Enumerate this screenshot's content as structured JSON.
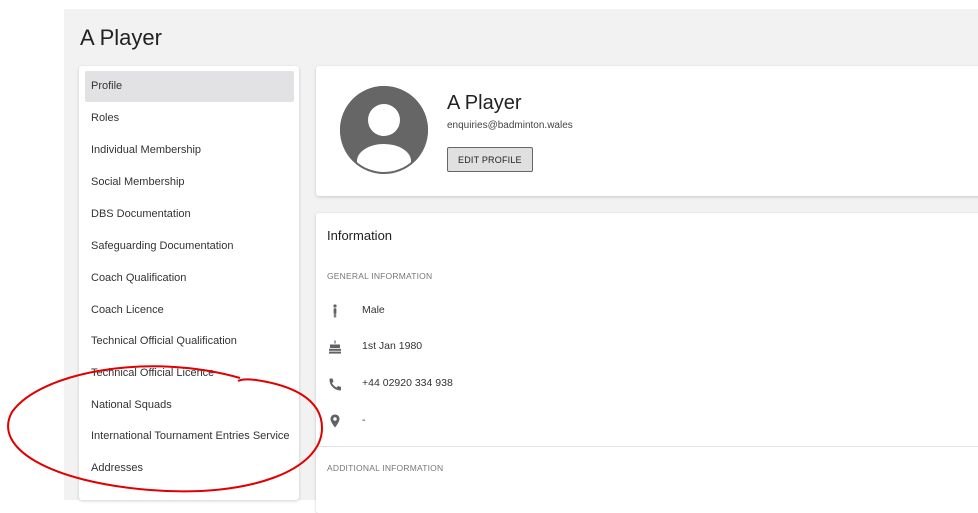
{
  "page": {
    "title": "A Player"
  },
  "sidebar": {
    "items": [
      {
        "label": "Profile",
        "active": true
      },
      {
        "label": "Roles"
      },
      {
        "label": "Individual Membership"
      },
      {
        "label": "Social Membership"
      },
      {
        "label": "DBS Documentation"
      },
      {
        "label": "Safeguarding Documentation"
      },
      {
        "label": "Coach Qualification"
      },
      {
        "label": "Coach Licence"
      },
      {
        "label": "Technical Official Qualification"
      },
      {
        "label": "Technical Official Licence"
      },
      {
        "label": "National Squads"
      },
      {
        "label": "International Tournament Entries Service"
      },
      {
        "label": "Addresses"
      }
    ]
  },
  "profile": {
    "name": "A Player",
    "email": "enquiries@badminton.wales",
    "edit_label": "EDIT PROFILE",
    "avatar_icon": "account-circle-icon"
  },
  "information": {
    "title": "Information",
    "general_label": "GENERAL INFORMATION",
    "rows": [
      {
        "icon": "person-icon",
        "value": "Male"
      },
      {
        "icon": "cake-icon",
        "value": "1st Jan 1980"
      },
      {
        "icon": "phone-icon",
        "value": "+44 02920 334 938"
      },
      {
        "icon": "location-pin-icon",
        "value": "-"
      }
    ],
    "additional_label": "ADDITIONAL INFORMATION"
  },
  "colors": {
    "background": "#f2f2f2",
    "active_nav": "#e2e2e5",
    "icon": "#5f6368",
    "annotation": "#e00000"
  }
}
